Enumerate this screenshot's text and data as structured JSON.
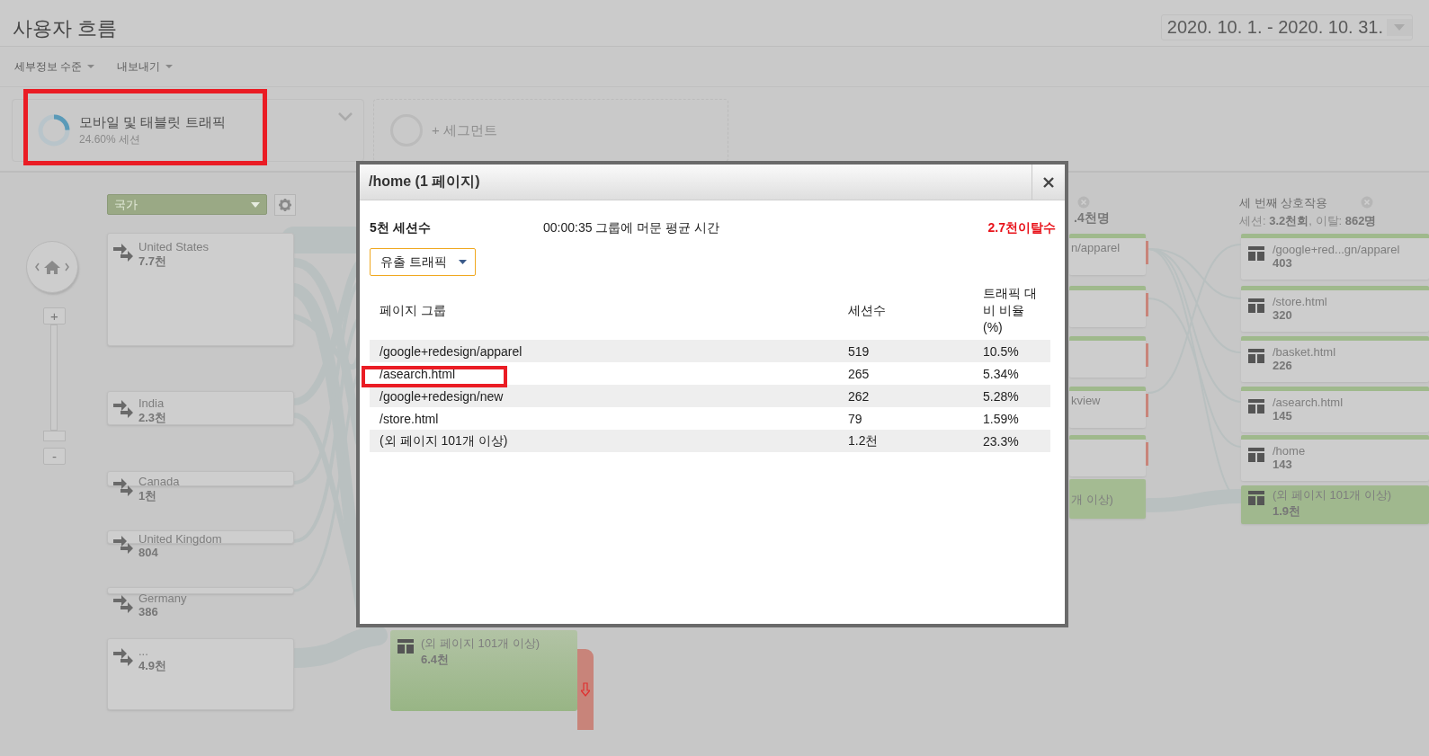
{
  "header": {
    "title": "사용자 흐름",
    "date_range": "2020. 10. 1. - 2020. 10. 31."
  },
  "toolbar": [
    {
      "label": "세부정보 수준"
    },
    {
      "label": "내보내기"
    }
  ],
  "segments": [
    {
      "kind": "segment",
      "name": "모바일 및 태블릿 트래픽",
      "detail": "24.60% 세션"
    },
    {
      "kind": "add",
      "name": "+ 세그먼트"
    }
  ],
  "dimension": {
    "label": "국가"
  },
  "zoom": {
    "in_label": "+",
    "out_label": "-"
  },
  "countries": [
    {
      "name": "United States",
      "count": "7.7천"
    },
    {
      "name": "India",
      "count": "2.3천"
    },
    {
      "name": "Canada",
      "count": "1천"
    },
    {
      "name": "United Kingdom",
      "count": "804"
    },
    {
      "name": "Germany",
      "count": "386"
    },
    {
      "name": "...",
      "count": "4.9천"
    }
  ],
  "column_2": {
    "nodes": [
      {
        "kind": "other",
        "label": "(외 페이지 101개 이상)",
        "count": "6.4천"
      }
    ]
  },
  "column_3": {
    "heading": ".4천명",
    "nodes": [
      {
        "kind": "page",
        "label": "n/apparel"
      },
      {
        "kind": "page"
      },
      {
        "kind": "page"
      },
      {
        "kind": "page",
        "label": "kview"
      },
      {
        "kind": "page"
      },
      {
        "kind": "other",
        "label": "개 이상)"
      }
    ]
  },
  "third_interaction": {
    "title": "세 번째 상호작용",
    "summary": "세션: **3.2천회**, 이탈: **862명**",
    "nodes": [
      {
        "kind": "page",
        "label": "/google+red...gn/apparel",
        "count": "403"
      },
      {
        "kind": "page",
        "label": "/store.html",
        "count": "320"
      },
      {
        "kind": "page",
        "label": "/basket.html",
        "count": "226"
      },
      {
        "kind": "page",
        "label": "/asearch.html",
        "count": "145"
      },
      {
        "kind": "page",
        "label": "/home",
        "count": "143"
      },
      {
        "kind": "other",
        "label": "(외 페이지 101개 이상)",
        "count": "1.9천"
      }
    ]
  },
  "modal": {
    "title": "/home (1 페이지)",
    "sessions": "5천 세션수",
    "avg_time": "00:00:35 그룹에 머문 평균 시간",
    "exits": "2.7천이탈수",
    "traffic_select": "유출 트래픽",
    "table": {
      "columns": [
        "페이지 그룹",
        "세션수",
        "트래픽 대비 비율 (%)"
      ],
      "rows": [
        [
          "/google+redesign/apparel",
          "519",
          "10.5%"
        ],
        [
          "/asearch.html",
          "265",
          "5.34%"
        ],
        [
          "/google+redesign/new",
          "262",
          "5.28%"
        ],
        [
          "/store.html",
          "79",
          "1.59%"
        ],
        [
          "(외 페이지 101개 이상)",
          "1.2천",
          "23.3%"
        ]
      ]
    }
  }
}
